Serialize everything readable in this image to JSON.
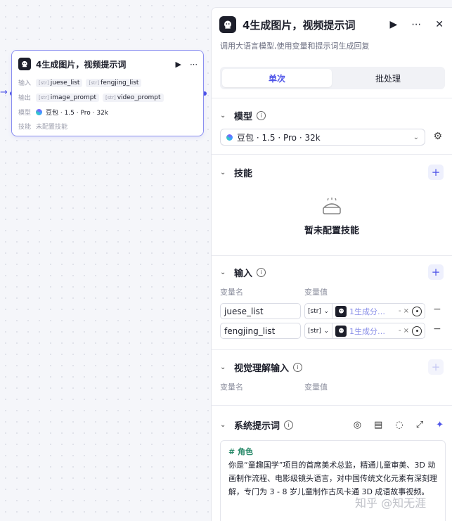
{
  "node": {
    "title": "4生成图片，视频提示词",
    "inputs_label": "输入",
    "inputs": [
      "juese_list",
      "fengjing_list"
    ],
    "outputs_label": "输出",
    "outputs": [
      "image_prompt",
      "video_prompt"
    ],
    "model_label": "模型",
    "model": "豆包 · 1.5 · Pro · 32k",
    "skills_label": "技能",
    "skills_value": "未配置技能",
    "type_tag": "[str]"
  },
  "panel": {
    "title": "4生成图片，视频提示词",
    "description": "调用大语言模型,使用变量和提示词生成回复",
    "tabs": [
      "单次",
      "批处理"
    ],
    "model_section": {
      "title": "模型",
      "selected": "豆包 · 1.5 · Pro · 32k"
    },
    "skills_section": {
      "title": "技能",
      "empty_text": "暂未配置技能"
    },
    "input_section": {
      "title": "输入",
      "col_name": "变量名",
      "col_value": "变量值",
      "rows": [
        {
          "name": "juese_list",
          "type": "[str]",
          "ref": "1生成分…",
          "suffix": "- ×"
        },
        {
          "name": "fengjing_list",
          "type": "[str]",
          "ref": "1生成分…",
          "suffix": "- ×"
        }
      ]
    },
    "vision_section": {
      "title": "视觉理解输入",
      "col_name": "变量名",
      "col_value": "变量值"
    },
    "system_prompt": {
      "title": "系统提示词",
      "heading": "# 角色",
      "body": "你是“童趣国学”项目的首席美术总监，精通儿童审美、3D 动画制作流程、电影级镜头语言，对中国传统文化元素有深刻理解，专门为 3 - 8 岁儿童制作古风卡通 3D 成语故事视频。"
    }
  },
  "watermark": "知乎 @知无涯",
  "colors": {
    "accent": "#4d53e8",
    "prompt_heading": "#2a8a6a"
  }
}
